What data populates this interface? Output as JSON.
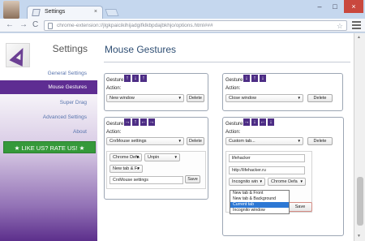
{
  "window": {
    "tab_title": "Settings",
    "tab_close": "×",
    "url": "chrome-extension://jlgkpaicikihijadgifklkbpdajbkhjo/options.html###"
  },
  "toolbar": {
    "back": "←",
    "forward": "→",
    "reload": "C",
    "bookmark": "☆"
  },
  "sidebar": {
    "title": "Settings",
    "items": [
      {
        "label": "General Settings"
      },
      {
        "label": "Mouse Gestures"
      },
      {
        "label": "Super Drag"
      },
      {
        "label": "Advanced Settings"
      },
      {
        "label": "About"
      }
    ],
    "like_label": "★  LIKE US? RATE US! ★"
  },
  "content": {
    "title": "Mouse Gestures",
    "panels": [
      {
        "gesture": "Gesture",
        "arrows": [
          "↑",
          "↓",
          "↑"
        ],
        "action": "Action:",
        "selected": "New window",
        "delete": "Delete"
      },
      {
        "gesture": "Gesture",
        "arrows": [
          "↓",
          "↑",
          "↓"
        ],
        "action": "Action:",
        "selected": "Close window",
        "delete": "Delete"
      },
      {
        "gesture": "Gesture",
        "arrows": [
          "→",
          "↑",
          "←",
          "→"
        ],
        "action": "Action:",
        "selected": "CrxMouse settings",
        "delete": "Delete",
        "sub_selects": [
          "Chrome Defa",
          "Unpin",
          "New tab & Fr"
        ],
        "sub_field": "CrxMouse settings",
        "save": "Save"
      },
      {
        "gesture": "Gesture",
        "arrows": [
          "→",
          "↓",
          "←",
          "↓"
        ],
        "action": "Action:",
        "selected": "Custom tab...",
        "delete": "Delete",
        "fields": [
          "lifehacker",
          "http://lifehacker.ru"
        ],
        "sub_selects": [
          "Incognito win",
          "Chrome Defa"
        ],
        "save": "Save"
      }
    ],
    "dropdown": [
      "New tab & Front",
      "New tab & Background",
      "Current tab",
      "Incognito window"
    ]
  },
  "colors": {
    "accent": "#5e2d92",
    "like": "#35993a",
    "selection": "#2d78d4"
  }
}
